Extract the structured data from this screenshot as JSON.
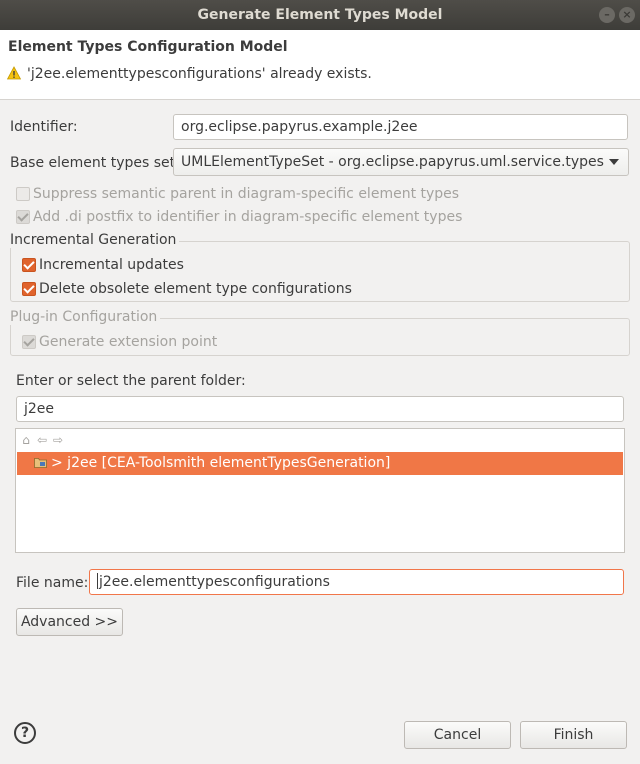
{
  "window": {
    "title": "Generate Element Types Model",
    "minimize_glyph": "–",
    "close_glyph": "×"
  },
  "header": {
    "title": "Element Types Configuration Model",
    "message": "'j2ee.elementtypesconfigurations' already exists.",
    "message_icon": "warning-icon"
  },
  "form": {
    "identifier_label": "Identifier:",
    "identifier_value": "org.eclipse.papyrus.example.j2ee",
    "base_label": "Base element types set:",
    "base_value": "UMLElementTypeSet - org.eclipse.papyrus.uml.service.types",
    "suppress_label": "Suppress semantic parent in diagram-specific element types",
    "suppress_checked": false,
    "suppress_enabled": false,
    "add_di_label": "Add .di postfix to identifier in diagram-specific element types",
    "add_di_checked": true,
    "add_di_enabled": false
  },
  "incremental": {
    "title": "Incremental Generation",
    "updates_label": "Incremental updates",
    "updates_checked": true,
    "delete_label": "Delete obsolete element type configurations",
    "delete_checked": true
  },
  "plugin": {
    "title": "Plug-in Configuration",
    "extension_label": "Generate extension point",
    "extension_checked": true,
    "extension_enabled": false
  },
  "folder": {
    "prompt": "Enter or select the parent folder:",
    "value": "j2ee",
    "tree_item": "> j2ee [CEA-Toolsmith elementTypesGeneration]",
    "toolbar_icons": [
      "home-icon",
      "back-icon",
      "forward-icon"
    ]
  },
  "file": {
    "label": "File name:",
    "value": "j2ee.elementtypesconfigurations"
  },
  "buttons": {
    "advanced": "Advanced >>",
    "cancel": "Cancel",
    "finish": "Finish",
    "help": "?"
  },
  "colors": {
    "accent": "#f07746",
    "checkbox": "#e0632c"
  }
}
